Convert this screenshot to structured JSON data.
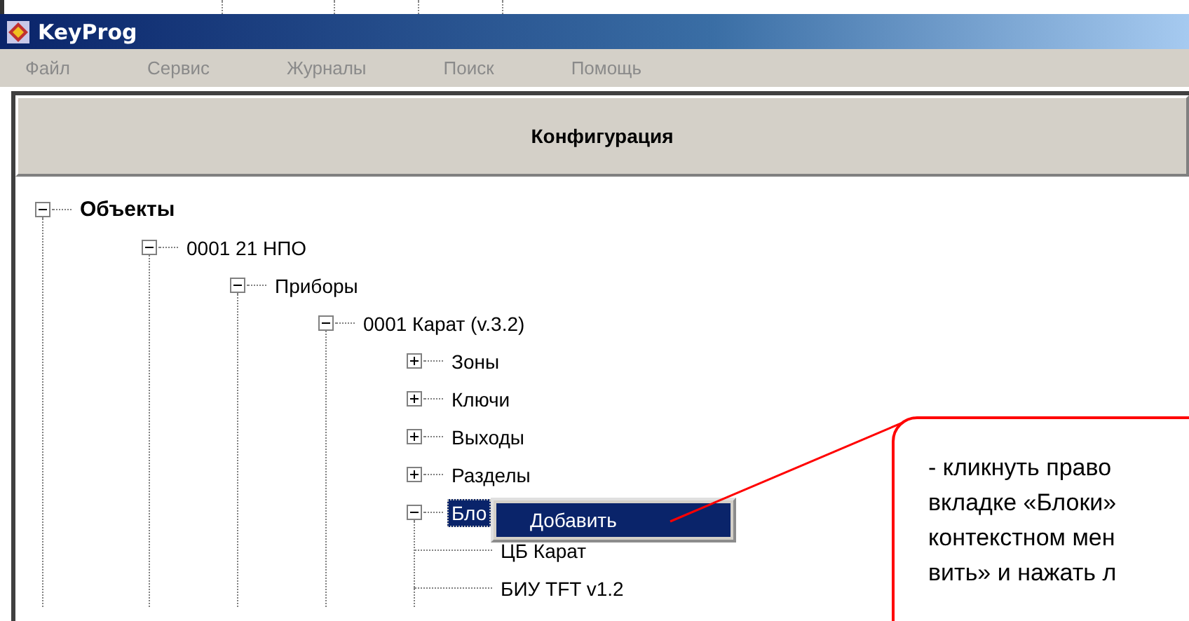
{
  "window": {
    "title": "KeyProg"
  },
  "menu": [
    {
      "label": "Файл",
      "disabled": true
    },
    {
      "label": "Сервис",
      "disabled": true
    },
    {
      "label": "Журналы",
      "disabled": true
    },
    {
      "label": "Поиск",
      "disabled": true
    },
    {
      "label": "Помощь",
      "disabled": true
    }
  ],
  "panel": {
    "title": "Конфигурация"
  },
  "tree": [
    {
      "label": "Объекты",
      "expanded": true,
      "selected": false,
      "children": [
        {
          "label": "0001  21  НПО",
          "expanded": true,
          "selected": false,
          "children": [
            {
              "label": "Приборы",
              "expanded": true,
              "selected": false,
              "children": [
                {
                  "label": "0001  Карат (v.3.2)",
                  "expanded": true,
                  "selected": false,
                  "children": [
                    {
                      "label": "Зоны",
                      "expanded": false,
                      "selected": false
                    },
                    {
                      "label": "Ключи",
                      "expanded": false,
                      "selected": false
                    },
                    {
                      "label": "Выходы",
                      "expanded": false,
                      "selected": false
                    },
                    {
                      "label": "Разделы",
                      "expanded": false,
                      "selected": false
                    },
                    {
                      "label": "Бло",
                      "expanded": true,
                      "selected": true,
                      "children": [
                        {
                          "label": "ЦБ Карат",
                          "selected": false
                        },
                        {
                          "label": "БИУ TFT v1.2",
                          "selected": false
                        }
                      ]
                    }
                  ]
                }
              ]
            }
          ]
        }
      ]
    }
  ],
  "context_menu": {
    "items": [
      {
        "label": "Добавить",
        "selected": true
      }
    ]
  },
  "callout": {
    "lines": [
      "- кликнуть право",
      "вкладке «Блоки»",
      "контекстном мен",
      "вить» и нажать л"
    ]
  }
}
